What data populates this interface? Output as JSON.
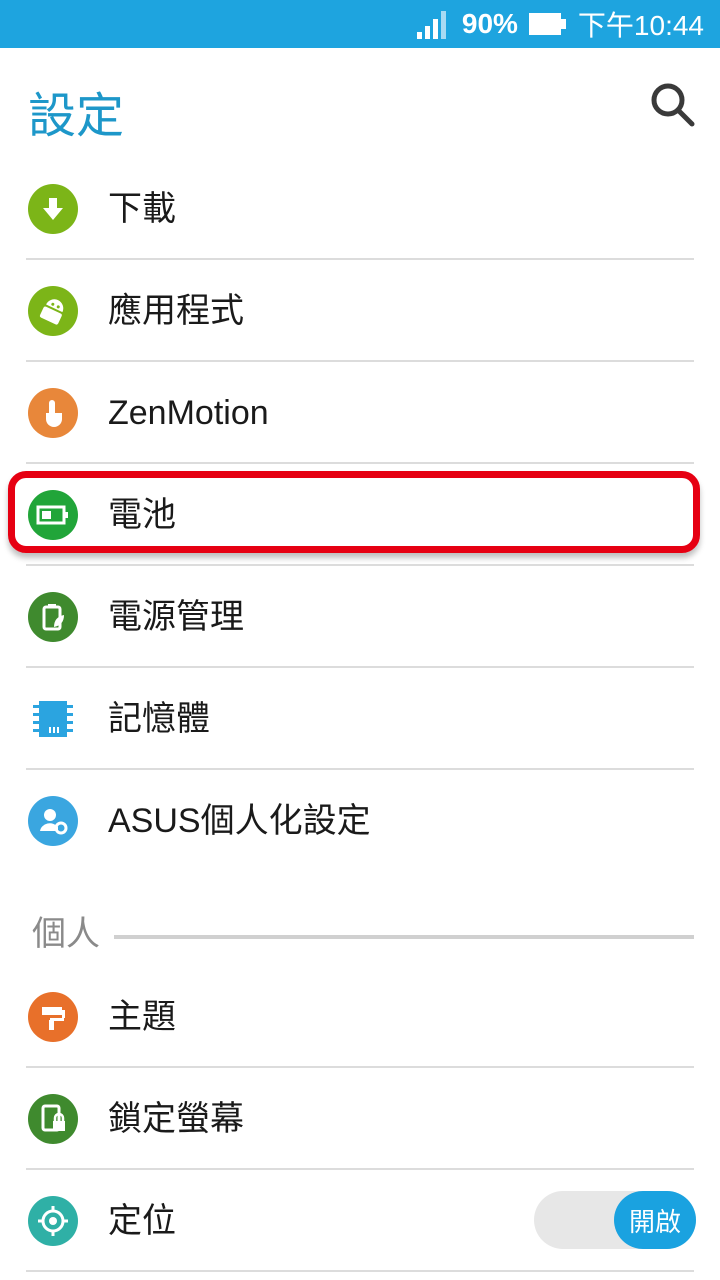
{
  "status_bar": {
    "battery_percent": "90%",
    "time": "下午10:44"
  },
  "header": {
    "title": "設定",
    "search_icon": "search-icon"
  },
  "items": [
    {
      "label": "下載",
      "icon": "download-icon",
      "color": "#7cb518"
    },
    {
      "label": "應用程式",
      "icon": "android-icon",
      "color": "#7cb518"
    },
    {
      "label": "ZenMotion",
      "icon": "hand-pointer-icon",
      "color": "#e8873a"
    },
    {
      "label": "電池",
      "icon": "battery-icon",
      "color": "#21a539"
    },
    {
      "label": "電源管理",
      "icon": "power-leaf-icon",
      "color": "#3f8a2e"
    },
    {
      "label": "記憶體",
      "icon": "memory-chip-icon",
      "color": "#2ba4e0"
    },
    {
      "label": "ASUS個人化設定",
      "icon": "user-gear-icon",
      "color": "#3aa6e0"
    }
  ],
  "section": {
    "label": "個人"
  },
  "personal_items": [
    {
      "label": "主題",
      "icon": "paint-roller-icon",
      "color": "#e8702a"
    },
    {
      "label": "鎖定螢幕",
      "icon": "lock-screen-icon",
      "color": "#3f8a2e"
    },
    {
      "label": "定位",
      "icon": "location-target-icon",
      "color": "#2fb0a6",
      "toggle_label": "開啟"
    }
  ]
}
